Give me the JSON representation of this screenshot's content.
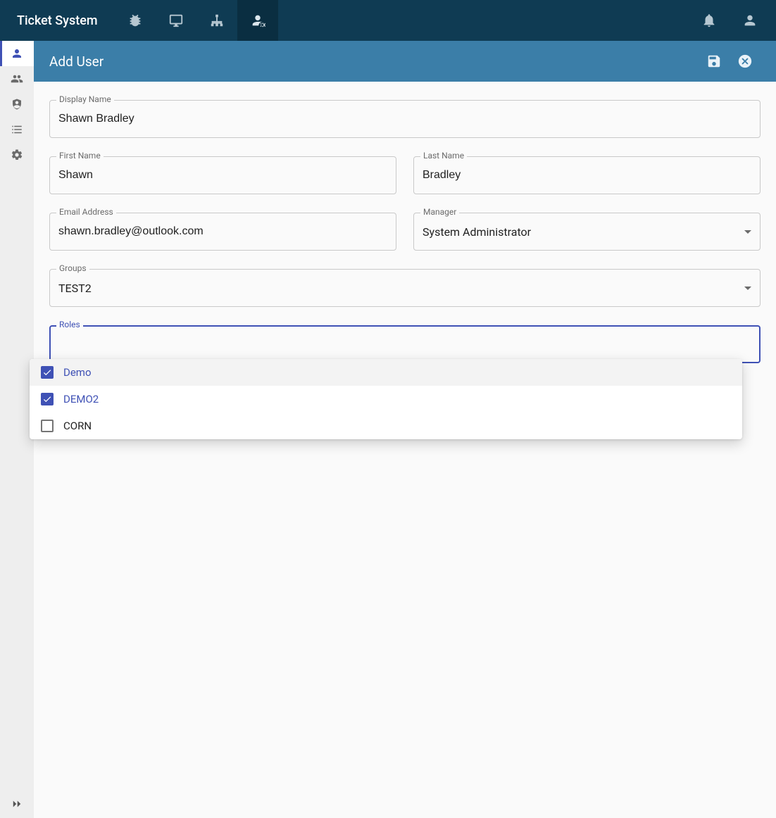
{
  "app": {
    "name": "Ticket System"
  },
  "page": {
    "title": "Add User"
  },
  "form": {
    "display_name": {
      "label": "Display Name",
      "value": "Shawn Bradley"
    },
    "first_name": {
      "label": "First Name",
      "value": "Shawn"
    },
    "last_name": {
      "label": "Last Name",
      "value": "Bradley"
    },
    "email": {
      "label": "Email Address",
      "value": "shawn.bradley@outlook.com"
    },
    "manager": {
      "label": "Manager",
      "value": "System Administrator"
    },
    "groups": {
      "label": "Groups",
      "value": "TEST2"
    },
    "roles": {
      "label": "Roles"
    }
  },
  "roles_menu": {
    "options": [
      {
        "label": "Demo",
        "checked": true
      },
      {
        "label": "DEMO2",
        "checked": true
      },
      {
        "label": "CORN",
        "checked": false
      }
    ]
  }
}
